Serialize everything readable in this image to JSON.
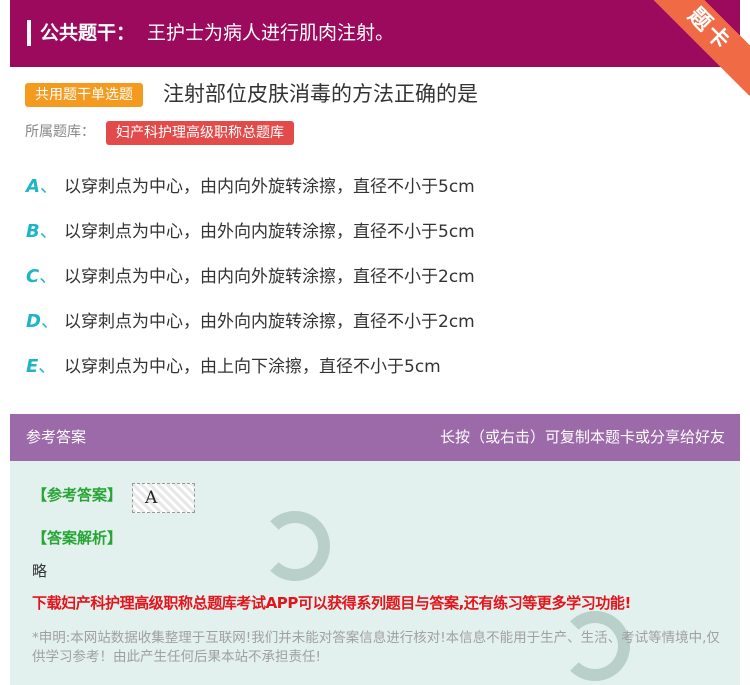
{
  "header": {
    "label": "公共题干：",
    "stem": "王护士为病人进行肌肉注射。",
    "corner_badge": "题卡",
    "accent_color": "#9b0a5c"
  },
  "question": {
    "type_tag": "共用题干单选题",
    "title": "注射部位皮肤消毒的方法正确的是",
    "bank_label": "所属题库：",
    "bank_name": "妇产科护理高级职称总题库"
  },
  "options": [
    {
      "letter": "A",
      "sep": "、",
      "text": "以穿刺点为中心，由内向外旋转涂擦，直径不小于5cm"
    },
    {
      "letter": "B",
      "sep": "、",
      "text": "以穿刺点为中心，由外向内旋转涂擦，直径不小于5cm"
    },
    {
      "letter": "C",
      "sep": "、",
      "text": "以穿刺点为中心，由内向外旋转涂擦，直径不小于2cm"
    },
    {
      "letter": "D",
      "sep": "、",
      "text": "以穿刺点为中心，由外向内旋转涂擦，直径不小于2cm"
    },
    {
      "letter": "E",
      "sep": "、",
      "text": "以穿刺点为中心，由上向下涂擦，直径不小于5cm"
    }
  ],
  "answer_bar": {
    "left": "参考答案",
    "right": "长按（或右击）可复制本题卡或分享给好友"
  },
  "answer": {
    "ref_label": "【参考答案】",
    "ref_value": "A",
    "analysis_label": "【答案解析】",
    "analysis_text": "略",
    "promo": "下载妇产科护理高级职称总题库考试APP可以获得系列题目与答案,还有练习等更多学习功能!",
    "disclaimer": "*申明:本网站数据收集整理于互联网!我们并未能对答案信息进行核对!本信息不能用于生产、生活、考试等情境中,仅供学习参考！由此产生任何后果本站不承担责任!"
  },
  "colors": {
    "option_letter": "#1fb5c7",
    "type_tag": "#f39a1f",
    "bank_tag": "#e34b4b",
    "answer_bar": "#9c6aa8",
    "answer_bg": "#e3f1ee",
    "answer_label": "#27a535",
    "promo": "#e3141b"
  }
}
